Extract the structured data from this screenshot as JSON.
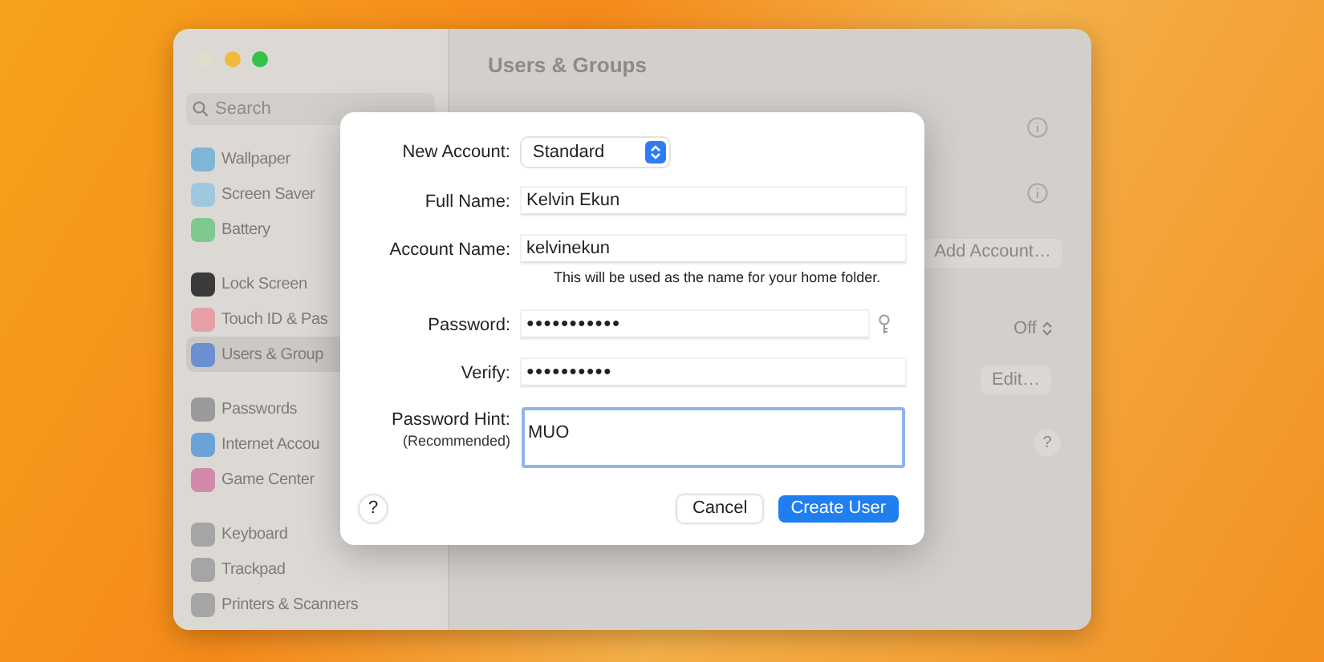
{
  "sidebar": {
    "search": {
      "placeholder": "Search"
    },
    "groups": [
      [
        {
          "label": "Wallpaper",
          "selected": false
        },
        {
          "label": "Screen Saver",
          "selected": false
        },
        {
          "label": "Battery",
          "selected": false
        }
      ],
      [
        {
          "label": "Lock Screen",
          "selected": false
        },
        {
          "label": "Touch ID & Pas",
          "selected": false
        },
        {
          "label": "Users & Group",
          "selected": true
        }
      ],
      [
        {
          "label": "Passwords",
          "selected": false
        },
        {
          "label": "Internet Accou",
          "selected": false
        },
        {
          "label": "Game Center",
          "selected": false
        }
      ],
      [
        {
          "label": "Keyboard",
          "selected": false
        },
        {
          "label": "Trackpad",
          "selected": false
        },
        {
          "label": "Printers & Scanners",
          "selected": false
        }
      ]
    ]
  },
  "main": {
    "title": "Users & Groups",
    "add_account_button": "Add Account…",
    "auto_login": {
      "value": "Off"
    },
    "edit_button": "Edit…",
    "help_button": "?"
  },
  "dialog": {
    "fields": [
      {
        "kind": "select",
        "label": "New Account:",
        "value": "Standard"
      },
      {
        "kind": "text",
        "label": "Full Name:",
        "value": "Kelvin Ekun"
      },
      {
        "kind": "text",
        "label": "Account Name:",
        "value": "kelvinekun",
        "hint": "This will be used as the name for your home folder."
      },
      {
        "kind": "password",
        "label": "Password:",
        "value": "●●●●●●●●●●●"
      },
      {
        "kind": "text",
        "label": "Verify:",
        "value": "●●●●●●●●●●"
      },
      {
        "kind": "textarea",
        "label": "Password Hint:",
        "sublabel": "(Recommended)",
        "value": "MUO"
      }
    ],
    "help_button": "?",
    "cancel_button": "Cancel",
    "create_button": "Create User"
  }
}
